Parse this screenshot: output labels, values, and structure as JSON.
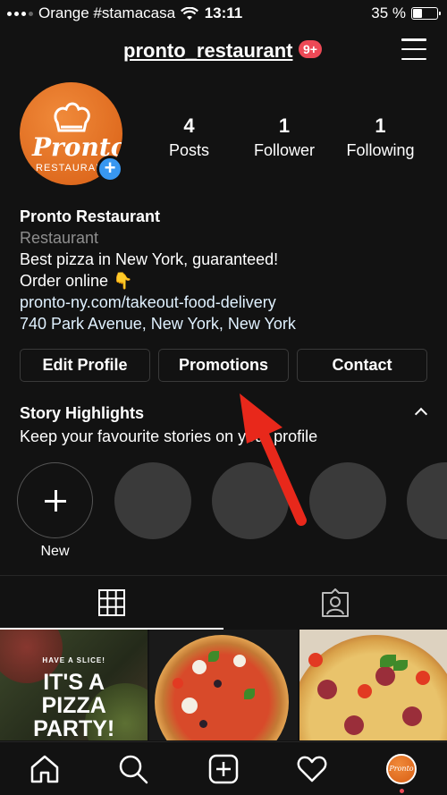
{
  "status_bar": {
    "carrier": "Orange #stamacasa",
    "time": "13:11",
    "battery": "35 %"
  },
  "header": {
    "username": "pronto_restaurant",
    "notifications": "9+"
  },
  "profile": {
    "avatar_text": "Pronto",
    "avatar_subtext": "RESTAURANT",
    "stats": [
      {
        "value": "4",
        "label": "Posts"
      },
      {
        "value": "1",
        "label": "Follower"
      },
      {
        "value": "1",
        "label": "Following"
      }
    ],
    "name": "Pronto Restaurant",
    "category": "Restaurant",
    "bio_line1": "Best pizza in New York, guaranteed!",
    "bio_line2": "Order online 👇",
    "website": "pronto-ny.com/takeout-food-delivery",
    "address": "740 Park Avenue, New York, New York"
  },
  "actions": {
    "edit_profile": "Edit Profile",
    "promotions": "Promotions",
    "contact": "Contact"
  },
  "highlights": {
    "title": "Story Highlights",
    "subtitle": "Keep your favourite stories on your profile",
    "new_label": "New"
  },
  "posts": {
    "post1_kicker": "HAVE A SLICE!",
    "post1_line1": "IT'S A",
    "post1_line2": "PIZZA",
    "post1_line3": "PARTY!"
  },
  "mini_avatar_text": "Pronto",
  "colors": {
    "background": "#121212",
    "badge": "#ed4956",
    "add_button": "#3897f0",
    "arrow": "#e8281b",
    "avatar": "#e0671f"
  },
  "icons": [
    "wifi-icon",
    "menu-icon",
    "grid-icon",
    "tagged-icon",
    "home-icon",
    "search-icon",
    "new-post-icon",
    "heart-icon"
  ]
}
